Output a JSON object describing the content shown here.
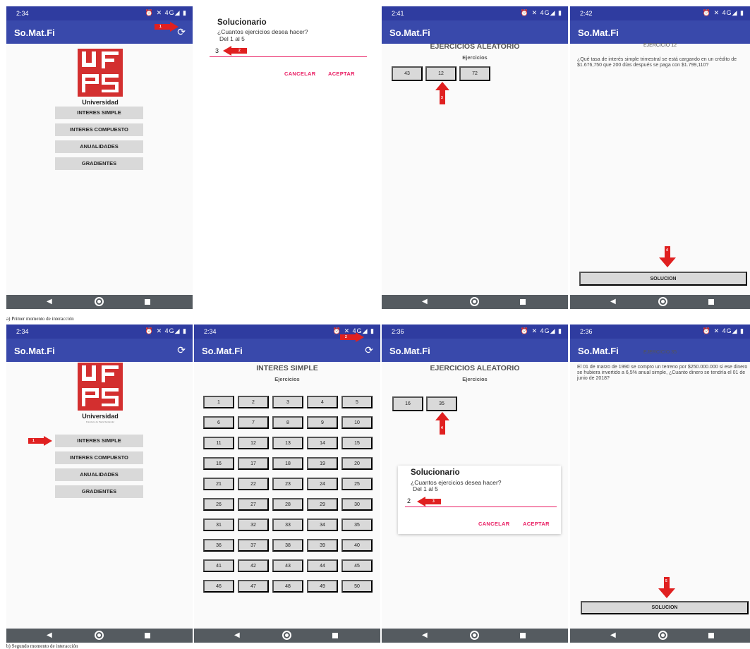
{
  "status_icons": "⏰ ✕ 4G◢ ▮",
  "app_title": "So.Mat.Fi",
  "refresh_icon": "⟳",
  "logo": {
    "letters": "UFPS",
    "text": "Universidad",
    "subtext": "Francisco de Paula Santander",
    "color": "#d32f2f"
  },
  "menu": [
    "INTERES SIMPLE",
    "INTERES COMPUESTO",
    "ANUALIDADES",
    "GRADIENTES"
  ],
  "dialog": {
    "title": "Solucionario",
    "message": "¿Cuantos ejercicios desea hacer?",
    "range": "Del 1 al 5",
    "cancel": "CANCELAR",
    "accept": "ACEPTAR"
  },
  "random_title": "EJERCICIOS ALEATORIO",
  "exercises_label": "Ejercicios",
  "simple_title": "INTERES SIMPLE",
  "solution_label": "SOLUCION",
  "row_a": {
    "s1_time": "2:34",
    "s1_arrow": "1",
    "s2_input": "3",
    "s2_arrow": "2",
    "s3_time": "2:41",
    "s3_buttons": [
      "43",
      "12",
      "72"
    ],
    "s3_arrow": "3",
    "s4_time": "2:42",
    "s4_ex_title": "EJERCICIO 12",
    "s4_ex_text": "¿Qué tasa de interés simple trimestral se está cargando en un crédito de $1.676,750 que 200 días después se paga con $1.799,110?",
    "s4_arrow": "4",
    "caption": "a) Primer momento de interacción"
  },
  "row_b": {
    "s1_time": "2:34",
    "s1_arrow": "1",
    "s2_time": "2:34",
    "s2_arrow": "2",
    "s2_grid": [
      "1",
      "2",
      "3",
      "4",
      "5",
      "6",
      "7",
      "8",
      "9",
      "10",
      "11",
      "12",
      "13",
      "14",
      "15",
      "16",
      "17",
      "18",
      "19",
      "20",
      "21",
      "22",
      "23",
      "24",
      "25",
      "26",
      "27",
      "28",
      "29",
      "30",
      "31",
      "32",
      "33",
      "34",
      "35",
      "36",
      "37",
      "38",
      "39",
      "40",
      "41",
      "42",
      "43",
      "44",
      "45",
      "46",
      "47",
      "48",
      "49",
      "50"
    ],
    "s3_time": "2:36",
    "s3_buttons": [
      "16",
      "35"
    ],
    "s3_arrow_a": "4",
    "s3_input": "2",
    "s3_arrow_b": "3",
    "s4_time": "2:36",
    "s4_ex_title": "EJERCICIO 35",
    "s4_ex_text": "El 01 de marzo de 1990 se compro un terreno por $250.000.000 si ese dinero se hubiera invertido a 6,5% anual simple, ¿Cuanto dinero se tendría el 01 de junio de 2018?",
    "s4_arrow": "5",
    "caption": "b) Segundo momento de interacción"
  },
  "colors": {
    "appbar": "#3949ab",
    "statusbar": "#2f3ca0",
    "navbar": "#555b60",
    "accent": "#e91e63",
    "arrow": "#e02020",
    "button": "#d9d9d9"
  },
  "icons": [
    "alarm-icon",
    "mute-icon",
    "signal-icon",
    "battery-icon",
    "refresh-icon",
    "back-icon",
    "home-icon",
    "recent-icon",
    "arrow-icon"
  ]
}
